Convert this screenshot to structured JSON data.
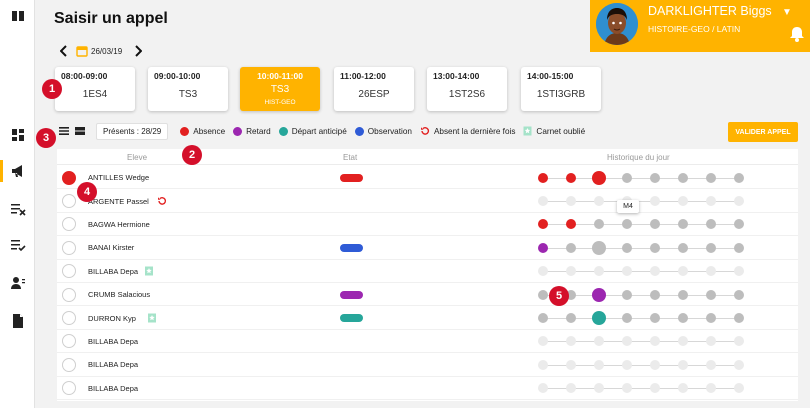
{
  "page": {
    "title": "Saisir un appel"
  },
  "date": {
    "value": "26/03/19"
  },
  "user": {
    "name": "DARKLIGHTER Biggs",
    "subject": "HISTOIRE-GEO / LATIN"
  },
  "slots": [
    {
      "time": "08:00-09:00",
      "cls": "1ES4",
      "sub": ""
    },
    {
      "time": "09:00-10:00",
      "cls": "TS3",
      "sub": ""
    },
    {
      "time": "10:00-11:00",
      "cls": "TS3",
      "sub": "HIST-GEO",
      "active": true
    },
    {
      "time": "11:00-12:00",
      "cls": "26ESP",
      "sub": ""
    },
    {
      "time": "13:00-14:00",
      "cls": "1ST2S6",
      "sub": ""
    },
    {
      "time": "14:00-15:00",
      "cls": "1STI3GRB",
      "sub": ""
    }
  ],
  "toolbar": {
    "presents": "Présents : 28/29",
    "validate": "VALIDER APPEL"
  },
  "legend": [
    {
      "label": "Absence",
      "color": "#e22020",
      "icon": "dot"
    },
    {
      "label": "Retard",
      "color": "#9c27b0",
      "icon": "dot"
    },
    {
      "label": "Départ anticipé",
      "color": "#26a69a",
      "icon": "dot"
    },
    {
      "label": "Observation",
      "color": "#2f5bd6",
      "icon": "dot"
    },
    {
      "label": "Absent la dernière fois",
      "color": "#e22020",
      "icon": "undo-icon"
    },
    {
      "label": "Carnet oublié",
      "color": "#a5e3c9",
      "icon": "bookmark-icon"
    }
  ],
  "table": {
    "headers": {
      "eleve": "Eleve",
      "etat": "Etat",
      "historique": "Historique du jour"
    },
    "rows": [
      {
        "name": "ANTILLES Wedge",
        "checked": true,
        "etat": "#e22020",
        "hist": [
          "#e22020",
          "#e22020",
          "big:#e22020",
          "g",
          "g",
          "g",
          "g",
          "g"
        ]
      },
      {
        "name": "ARGENTE Passel",
        "icon": "undo-icon",
        "hist": [
          "f",
          "f",
          "f",
          "f",
          "f",
          "f",
          "f",
          "f"
        ]
      },
      {
        "name": "BAGWA Hermione",
        "hist": [
          "#e22020",
          "#e22020",
          "g",
          "g",
          "g",
          "g",
          "g",
          "g"
        ]
      },
      {
        "name": "BANAI Kirster",
        "etat": "#2f5bd6",
        "hist": [
          "#9c27b0",
          "g",
          "big:#bdbdbd",
          "g",
          "g",
          "g",
          "g",
          "g"
        ]
      },
      {
        "name": "BILLABA Depa",
        "icon": "bookmark-icon",
        "hist": [
          "f",
          "f",
          "f",
          "f",
          "f",
          "f",
          "f",
          "f"
        ]
      },
      {
        "name": "CRUMB Salacious",
        "etat": "#9c27b0",
        "hist": [
          "g",
          "g",
          "big:#9c27b0",
          "g",
          "g",
          "g",
          "g",
          "g"
        ]
      },
      {
        "name": "DURRON Kyp",
        "icon": "bookmark-icon",
        "etat": "#26a69a",
        "hist": [
          "g",
          "g",
          "big:#26a69a",
          "g",
          "g",
          "g",
          "g",
          "g"
        ]
      },
      {
        "name": "BILLABA Depa",
        "hist": [
          "f",
          "f",
          "f",
          "f",
          "f",
          "f",
          "f",
          "f"
        ]
      },
      {
        "name": "BILLABA Depa",
        "hist": [
          "f",
          "f",
          "f",
          "f",
          "f",
          "f",
          "f",
          "f"
        ]
      },
      {
        "name": "BILLABA Depa",
        "hist": [
          "f",
          "f",
          "f",
          "f",
          "f",
          "f",
          "f",
          "f"
        ]
      }
    ]
  },
  "tooltip": {
    "text": "M4"
  },
  "badges": [
    "1",
    "2",
    "3",
    "4",
    "5"
  ]
}
